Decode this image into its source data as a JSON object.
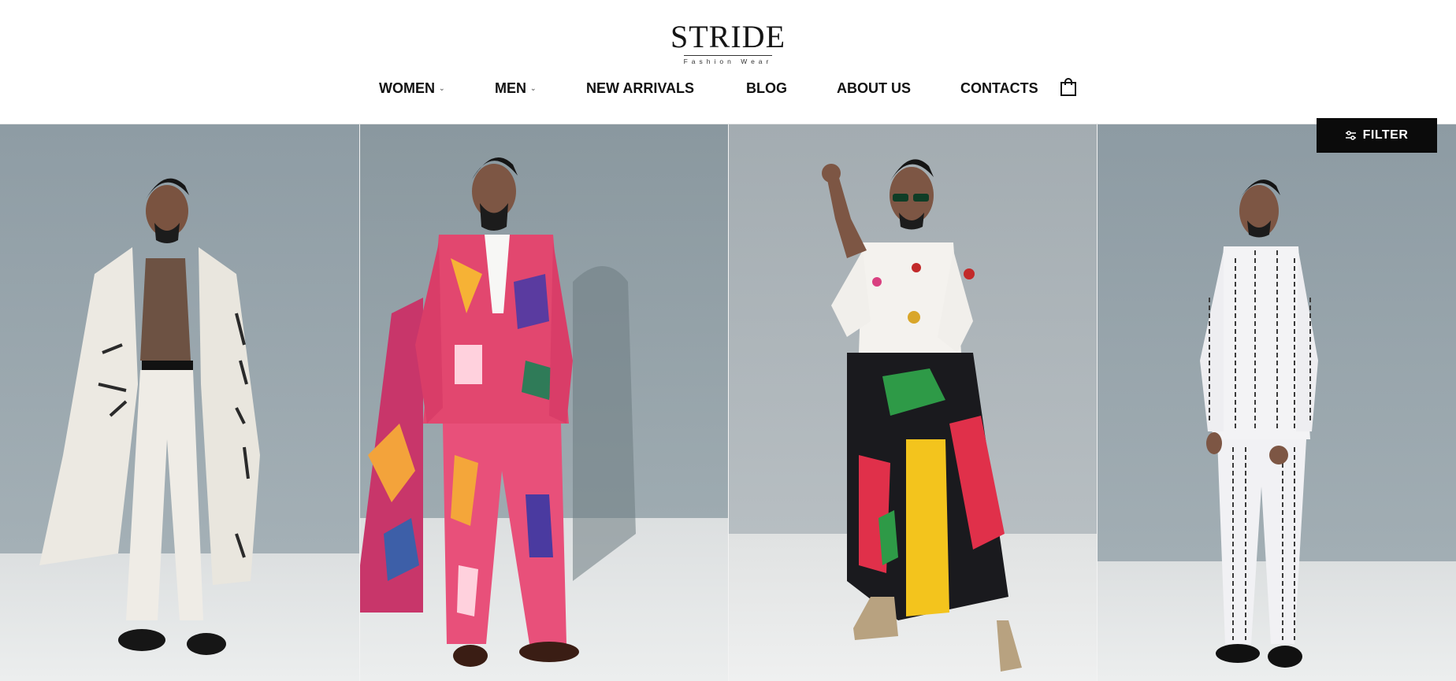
{
  "brand": {
    "name": "STRIDE",
    "tagline": "Fashion Wear"
  },
  "nav": {
    "items": [
      {
        "label": "WOMEN",
        "has_dropdown": true
      },
      {
        "label": "MEN",
        "has_dropdown": true
      },
      {
        "label": "NEW ARRIVALS",
        "has_dropdown": false
      },
      {
        "label": "BLOG",
        "has_dropdown": false
      },
      {
        "label": "ABOUT US",
        "has_dropdown": false
      },
      {
        "label": "CONTACTS",
        "has_dropdown": false
      }
    ],
    "cart_icon": "shopping-bag-icon"
  },
  "filter": {
    "label": "FILTER",
    "icon": "sliders-icon"
  },
  "products": [
    {
      "description": "white calligraphy long coat with white trousers",
      "wall_color": "#9aa7ae",
      "floor_color": "#e3e5e5"
    },
    {
      "description": "pink multicolor graphic print suit",
      "wall_color": "#8f9da3",
      "floor_color": "#e1e3e3"
    },
    {
      "description": "white shirt with multicolor graphic wrap skirt",
      "wall_color": "#a8b1b6",
      "floor_color": "#e6e7e7"
    },
    {
      "description": "white suit with black text print",
      "wall_color": "#97a5ad",
      "floor_color": "#dfe2e3"
    }
  ],
  "colors": {
    "header_bg": "#ffffff",
    "text": "#111111",
    "filter_bg": "#0b0b0b",
    "filter_text": "#ffffff"
  }
}
